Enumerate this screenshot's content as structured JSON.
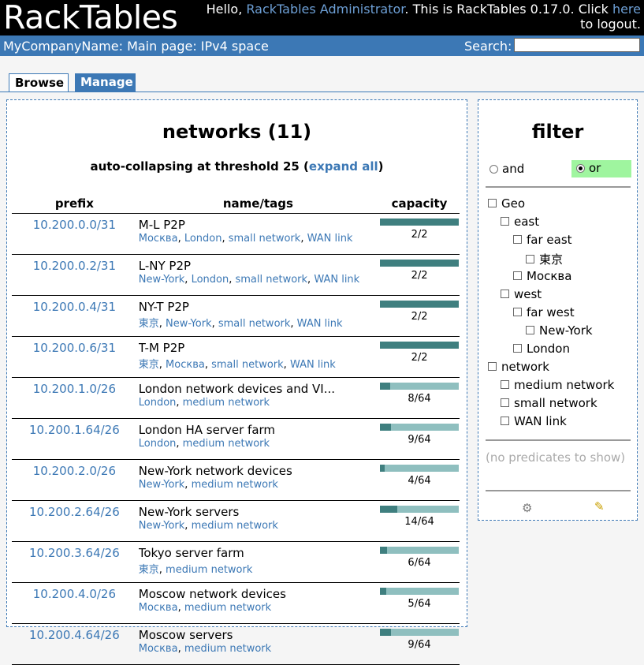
{
  "header": {
    "logo": "RackTables",
    "greeting_pre": "Hello, ",
    "user": "RackTables Administrator",
    "greeting_mid": ". This is RackTables 0.17.0. Click ",
    "here": "here",
    "greeting_post": " to logout."
  },
  "bar": {
    "breadcrumb": "MyCompanyName: Main page: IPv4 space",
    "search_label": "Search:",
    "search_value": ""
  },
  "tabs": {
    "browse": "Browse",
    "manage": "Manage"
  },
  "networks": {
    "title": "networks (11)",
    "autocollapse_pre": "auto-collapsing at threshold 25 (",
    "expand_all": "expand all",
    "autocollapse_post": ")",
    "headers": {
      "prefix": "prefix",
      "name": "name/tags",
      "capacity": "capacity"
    },
    "rows": [
      {
        "prefix": "10.200.0.0/31",
        "name": "M-L P2P",
        "tags": [
          "Москва",
          "London",
          "small network",
          "WAN link"
        ],
        "capacity": "2/2",
        "fill": 1.0
      },
      {
        "prefix": "10.200.0.2/31",
        "name": "L-NY P2P",
        "tags": [
          "New-York",
          "London",
          "small network",
          "WAN link"
        ],
        "capacity": "2/2",
        "fill": 1.0
      },
      {
        "prefix": "10.200.0.4/31",
        "name": "NY-T P2P",
        "tags": [
          "東京",
          "New-York",
          "small network",
          "WAN link"
        ],
        "capacity": "2/2",
        "fill": 1.0
      },
      {
        "prefix": "10.200.0.6/31",
        "name": "T-M P2P",
        "tags": [
          "東京",
          "Москва",
          "small network",
          "WAN link"
        ],
        "capacity": "2/2",
        "fill": 1.0
      },
      {
        "prefix": "10.200.1.0/26",
        "name": "London network devices and VI...",
        "tags": [
          "London",
          "medium network"
        ],
        "capacity": "8/64",
        "fill": 0.125
      },
      {
        "prefix": "10.200.1.64/26",
        "name": "London HA server farm",
        "tags": [
          "London",
          "medium network"
        ],
        "capacity": "9/64",
        "fill": 0.14
      },
      {
        "prefix": "10.200.2.0/26",
        "name": "New-York network devices",
        "tags": [
          "New-York",
          "medium network"
        ],
        "capacity": "4/64",
        "fill": 0.0625
      },
      {
        "prefix": "10.200.2.64/26",
        "name": "New-York servers",
        "tags": [
          "New-York",
          "medium network"
        ],
        "capacity": "14/64",
        "fill": 0.22
      },
      {
        "prefix": "10.200.3.64/26",
        "name": "Tokyo server farm",
        "tags": [
          "東京",
          "medium network"
        ],
        "capacity": "6/64",
        "fill": 0.094
      },
      {
        "prefix": "10.200.4.0/26",
        "name": "Moscow network devices",
        "tags": [
          "Москва",
          "medium network"
        ],
        "capacity": "5/64",
        "fill": 0.078
      },
      {
        "prefix": "10.200.4.64/26",
        "name": "Moscow servers",
        "tags": [
          "Москва",
          "medium network"
        ],
        "capacity": "9/64",
        "fill": 0.14
      }
    ]
  },
  "filter": {
    "title": "filter",
    "and_label": "and",
    "or_label": "or",
    "selected": "or",
    "tree": [
      {
        "label": "Geo",
        "depth": 0
      },
      {
        "label": "east",
        "depth": 1
      },
      {
        "label": "far east",
        "depth": 2
      },
      {
        "label": "東京",
        "depth": 3
      },
      {
        "label": "Москва",
        "depth": 2
      },
      {
        "label": "west",
        "depth": 1
      },
      {
        "label": "far west",
        "depth": 2
      },
      {
        "label": "New-York",
        "depth": 3
      },
      {
        "label": "London",
        "depth": 2
      },
      {
        "label": "network",
        "depth": 0
      },
      {
        "label": "medium network",
        "depth": 1
      },
      {
        "label": "small network",
        "depth": 1
      },
      {
        "label": "WAN link",
        "depth": 1
      }
    ],
    "no_predicates": "(no predicates to show)",
    "icons": {
      "apply": "gear-icon",
      "reset": "broom-icon"
    }
  },
  "colors": {
    "accent": "#3c78b5",
    "cap_used": "#3f7f7f",
    "cap_free": "#8fbfbf",
    "or_highlight": "#9ff59f"
  }
}
